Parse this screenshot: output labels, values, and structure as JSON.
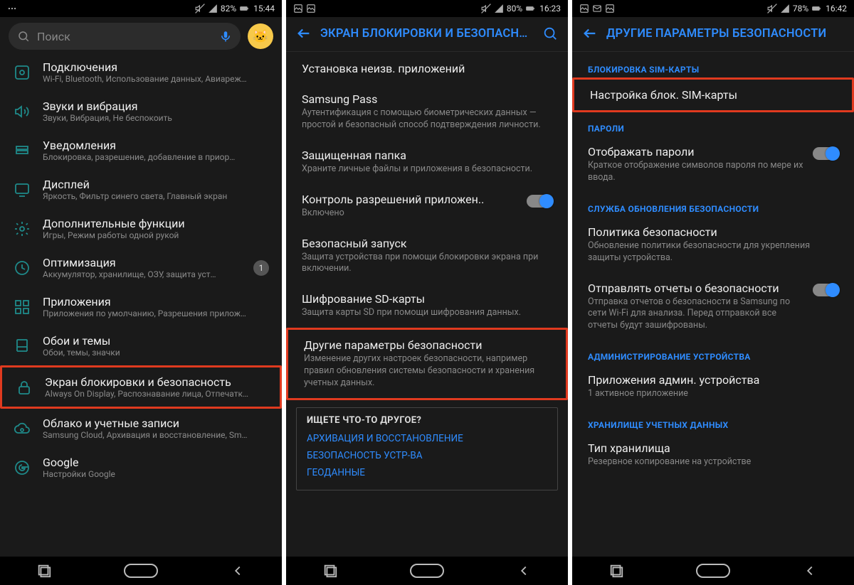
{
  "phone1": {
    "status": {
      "battery": "82%",
      "time": "15:44"
    },
    "search_placeholder": "Поиск",
    "items": [
      {
        "icon": "connections",
        "title": "Подключения",
        "sub": "Wi-Fi, Bluetooth, Использование данных, Авиареж…"
      },
      {
        "icon": "sound",
        "title": "Звуки и вибрация",
        "sub": "Звуки, Вибрация, Не беспокоить"
      },
      {
        "icon": "notif",
        "title": "Уведомления",
        "sub": "Блокировка, разрешение, добавление в приор…"
      },
      {
        "icon": "display",
        "title": "Дисплей",
        "sub": "Яркость, Фильтр синего света, Главный экран"
      },
      {
        "icon": "advanced",
        "title": "Дополнительные функции",
        "sub": "Игры, Режим работы одной рукой"
      },
      {
        "icon": "optimize",
        "title": "Оптимизация",
        "sub": "Аккумулятор, хранилище, ОЗУ, защита уст…",
        "badge": "1"
      },
      {
        "icon": "apps",
        "title": "Приложения",
        "sub": "Приложения по умолчанию, Разрешения прилож…"
      },
      {
        "icon": "wallpaper",
        "title": "Обои и темы",
        "sub": "Обои, темы, значки"
      },
      {
        "icon": "lock",
        "title": "Экран блокировки и безопасность",
        "sub": "Always On Display, Распознавание лица, Отпечатк…",
        "highlight": true
      },
      {
        "icon": "cloud",
        "title": "Облако и учетные записи",
        "sub": "Samsung Cloud, Архивация и восстановление, Sm…"
      },
      {
        "icon": "google",
        "title": "Google",
        "sub": "Настройки Google"
      }
    ]
  },
  "phone2": {
    "status": {
      "battery": "80%",
      "time": "16:23"
    },
    "header": "ЭКРАН БЛОКИРОВКИ И БЕЗОПАСНОСТЬ",
    "items": [
      {
        "title": "Установка неизв. приложений"
      },
      {
        "title": "Samsung Pass",
        "sub": "Аутентификация с помощью биометрических данных — простой и безопасный способ подтверждения личности."
      },
      {
        "title": "Защищенная папка",
        "sub": "Храните личные файлы и приложения в безопасности."
      },
      {
        "title": "Контроль разрешений приложен..",
        "sub": "Включено",
        "toggle": true
      },
      {
        "title": "Безопасный запуск",
        "sub": "Защита устройства при помощи блокировки экрана при включении."
      },
      {
        "title": "Шифрование SD-карты",
        "sub": "Защита карты SD при помощи шифрования данных."
      },
      {
        "title": "Другие параметры безопасности",
        "sub": "Изменение других настроек безопасности, например правил обновления системы безопасности и хранения учетных данных.",
        "highlight": true
      }
    ],
    "seek_title": "ИЩЕТЕ ЧТО-ТО ДРУГОЕ?",
    "seek_links": [
      "АРХИВАЦИЯ И ВОССТАНОВЛЕНИЕ",
      "БЕЗОПАСНОСТЬ УСТР-ВА",
      "ГЕОДАННЫЕ"
    ]
  },
  "phone3": {
    "status": {
      "battery": "78%",
      "time": "16:42"
    },
    "header": "ДРУГИЕ ПАРАМЕТРЫ БЕЗОПАСНОСТИ",
    "sections": [
      {
        "label": "БЛОКИРОВКА SIM-КАРТЫ",
        "items": [
          {
            "title": "Настройка блок. SIM-карты",
            "highlight": true
          }
        ]
      },
      {
        "label": "ПАРОЛИ",
        "items": [
          {
            "title": "Отображать пароли",
            "sub": "Краткое отображение символов пароля по мере их ввода.",
            "toggle": true
          }
        ]
      },
      {
        "label": "СЛУЖБА ОБНОВЛЕНИЯ БЕЗОПАСНОСТИ",
        "items": [
          {
            "title": "Политика безопасности",
            "sub": "Обновление политики безопасности для укрепления защиты устройства."
          },
          {
            "title": "Отправлять отчеты о безопасности",
            "sub": "Отправка отчетов о безопасности в Samsung по сети Wi-Fi для анализа. Перед отправкой все отчеты будут зашифрованы.",
            "toggle": true
          }
        ]
      },
      {
        "label": "АДМИНИСТРИРОВАНИЕ УСТРОЙСТВА",
        "items": [
          {
            "title": "Приложения админ. устройства",
            "sub": "1 активное приложение"
          }
        ]
      },
      {
        "label": "ХРАНИЛИЩЕ УЧЕТНЫХ ДАННЫХ",
        "items": [
          {
            "title": "Тип хранилища",
            "sub": "Резервное копирование на устройстве"
          }
        ]
      }
    ]
  }
}
